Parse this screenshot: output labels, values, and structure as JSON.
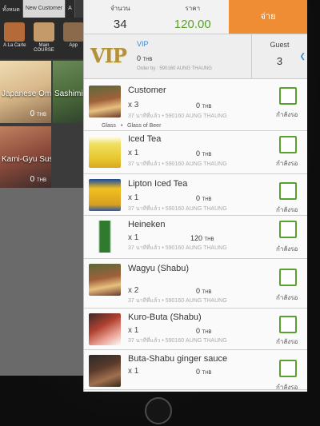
{
  "menu": {
    "tabs": [
      "ทั้งหมด",
      "New Customer",
      "A"
    ],
    "categories": [
      {
        "label": "A La Carte",
        "color": "#b56a3a"
      },
      {
        "label": "Main COURSE",
        "color": "#c59a6a"
      },
      {
        "label": "App",
        "color": "#8a6a4a"
      }
    ],
    "items": [
      {
        "label": "Japanese Omelet",
        "price": "0",
        "unit": "THB",
        "color": "#d8b88a"
      },
      {
        "label": "Sashimi",
        "price": "",
        "unit": "",
        "color": "#4a6a3a"
      },
      {
        "label": "Kami-Gyu Sushi",
        "price": "0",
        "unit": "THB",
        "color": "#8a4a3a"
      }
    ]
  },
  "summary": {
    "count_label": "จำนวน",
    "count_value": "34",
    "price_label": "ราคา",
    "price_value": "120.00",
    "pay_label": "จ่าย"
  },
  "vip": {
    "logo": "VIP",
    "name": "VIP",
    "total": "0",
    "unit": "THB",
    "order_by": "Order by : 590160 AUNG THAUNG",
    "guest_label": "Guest",
    "guest_value": "3"
  },
  "orders": [
    {
      "name": "Customer",
      "qty": "x 3",
      "price": "0",
      "unit": "THB",
      "meta": "37 นาทีที่แล้ว  •  590160 AUNG THAUNG",
      "status": "กำลังรอ",
      "tags": [
        "Glass",
        "•",
        "Glass of Beer"
      ],
      "pic_color": "#a0603a"
    },
    {
      "name": "Iced Tea",
      "qty": "x 1",
      "price": "0",
      "unit": "THB",
      "meta": "37 นาทีที่แล้ว  •  590160 AUNG THAUNG",
      "status": "กำลังรอ",
      "tags": [],
      "pic_color": "#e8c830"
    },
    {
      "name": "Lipton Iced Tea",
      "qty": "x 1",
      "price": "0",
      "unit": "THB",
      "meta": "37 นาทีที่แล้ว  •  590160 AUNG THAUNG",
      "status": "กำลังรอ",
      "tags": [],
      "pic_color": "#d8a020"
    },
    {
      "name": "Heineken",
      "qty": "x 1",
      "price": "120",
      "unit": "THB",
      "meta": "37 นาทีที่แล้ว  •  590160 AUNG THAUNG",
      "status": "กำลังรอ",
      "tags": [],
      "pic_color": "#2f7a2f"
    },
    {
      "name": "Wagyu (Shabu)",
      "qty": "x 2",
      "price": "0",
      "unit": "THB",
      "meta": "37 นาทีที่แล้ว  •  590160 AUNG THAUNG",
      "status": "กำลังรอ",
      "tags": [],
      "pic_color": "#a0603a"
    },
    {
      "name": "Kuro-Buta (Shabu)",
      "qty": "x 1",
      "price": "0",
      "unit": "THB",
      "meta": "37 นาทีที่แล้ว  •  590160 AUNG THAUNG",
      "status": "กำลังรอ",
      "tags": [],
      "pic_color": "#b04030"
    },
    {
      "name": "Buta-Shabu ginger sauce",
      "qty": "x 1",
      "price": "0",
      "unit": "THB",
      "meta": "",
      "status": "กำลังรอ",
      "tags": [],
      "pic_color": "#5a3a2a"
    }
  ]
}
